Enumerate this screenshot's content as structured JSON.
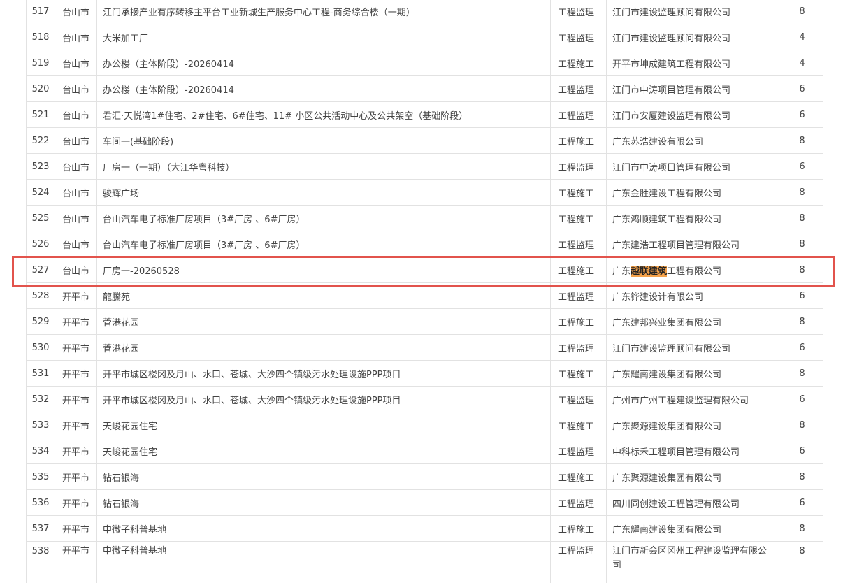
{
  "colors": {
    "highlight_box": "#e2534c",
    "search_highlight": "#f5a24a",
    "border": "#e2e2e2",
    "text": "#444444"
  },
  "rows": [
    {
      "no": "517",
      "city": "台山市",
      "project": "江门承接产业有序转移主平台工业新城生产服务中心工程-商务综合楼（一期）",
      "type": "工程监理",
      "company": "江门市建设监理顾问有限公司",
      "score": "8"
    },
    {
      "no": "518",
      "city": "台山市",
      "project": "大米加工厂",
      "type": "工程监理",
      "company": "江门市建设监理顾问有限公司",
      "score": "4"
    },
    {
      "no": "519",
      "city": "台山市",
      "project": "办公楼（主体阶段）-20260414",
      "type": "工程施工",
      "company": "开平市坤成建筑工程有限公司",
      "score": "4"
    },
    {
      "no": "520",
      "city": "台山市",
      "project": "办公楼（主体阶段）-20260414",
      "type": "工程监理",
      "company": "江门市中涛项目管理有限公司",
      "score": "6"
    },
    {
      "no": "521",
      "city": "台山市",
      "project": "君汇·天悦湾1#住宅、2#住宅、6#住宅、11# 小区公共活动中心及公共架空（基础阶段）",
      "type": "工程监理",
      "company": "江门市安厦建设监理有限公司",
      "score": "6"
    },
    {
      "no": "522",
      "city": "台山市",
      "project": "车间一(基础阶段)",
      "type": "工程施工",
      "company": "广东苏浩建设有限公司",
      "score": "8"
    },
    {
      "no": "523",
      "city": "台山市",
      "project": "厂房一（一期）（大江华粤科技）",
      "type": "工程监理",
      "company": "江门市中涛项目管理有限公司",
      "score": "6"
    },
    {
      "no": "524",
      "city": "台山市",
      "project": "骏辉广场",
      "type": "工程施工",
      "company": "广东金胜建设工程有限公司",
      "score": "8"
    },
    {
      "no": "525",
      "city": "台山市",
      "project": "台山汽车电子标准厂房项目（3#厂房 、6#厂房）",
      "type": "工程施工",
      "company": "广东鸿顺建筑工程有限公司",
      "score": "8"
    },
    {
      "no": "526",
      "city": "台山市",
      "project": "台山汽车电子标准厂房项目（3#厂房 、6#厂房）",
      "type": "工程监理",
      "company": "广东建浩工程项目管理有限公司",
      "score": "8"
    },
    {
      "no": "527",
      "city": "台山市",
      "project": "厂房一-20260528",
      "type": "工程施工",
      "company_pre": "广东",
      "company_hl": "越联建筑",
      "company_post": "工程有限公司",
      "score": "8"
    },
    {
      "no": "528",
      "city": "开平市",
      "project": "龍騰苑",
      "type": "工程监理",
      "company": "广东铧建设计有限公司",
      "score": "6"
    },
    {
      "no": "529",
      "city": "开平市",
      "project": "菅港花园",
      "type": "工程施工",
      "company": "广东建邦兴业集团有限公司",
      "score": "8"
    },
    {
      "no": "530",
      "city": "开平市",
      "project": "菅港花园",
      "type": "工程监理",
      "company": "江门市建设监理顾问有限公司",
      "score": "6"
    },
    {
      "no": "531",
      "city": "开平市",
      "project": "开平市城区楼冈及月山、水口、苍城、大沙四个镇级污水处理设施PPP项目",
      "type": "工程施工",
      "company": "广东耀南建设集团有限公司",
      "score": "8"
    },
    {
      "no": "532",
      "city": "开平市",
      "project": "开平市城区楼冈及月山、水口、苍城、大沙四个镇级污水处理设施PPP项目",
      "type": "工程监理",
      "company": "广州市广州工程建设监理有限公司",
      "score": "6"
    },
    {
      "no": "533",
      "city": "开平市",
      "project": "天峻花园住宅",
      "type": "工程施工",
      "company": "广东聚源建设集团有限公司",
      "score": "8"
    },
    {
      "no": "534",
      "city": "开平市",
      "project": "天峻花园住宅",
      "type": "工程监理",
      "company": "中科标禾工程项目管理有限公司",
      "score": "6"
    },
    {
      "no": "535",
      "city": "开平市",
      "project": "钻石银海",
      "type": "工程施工",
      "company": "广东聚源建设集团有限公司",
      "score": "8"
    },
    {
      "no": "536",
      "city": "开平市",
      "project": "钻石银海",
      "type": "工程监理",
      "company": "四川同创建设工程管理有限公司",
      "score": "6"
    },
    {
      "no": "537",
      "city": "开平市",
      "project": "中微子科普基地",
      "type": "工程施工",
      "company": "广东耀南建设集团有限公司",
      "score": "8"
    },
    {
      "no": "538",
      "city": "开平市",
      "project": "中微子科普基地",
      "type": "工程监理",
      "company": "江门市新会区冈州工程建设监理有限公司",
      "score": "8"
    }
  ]
}
